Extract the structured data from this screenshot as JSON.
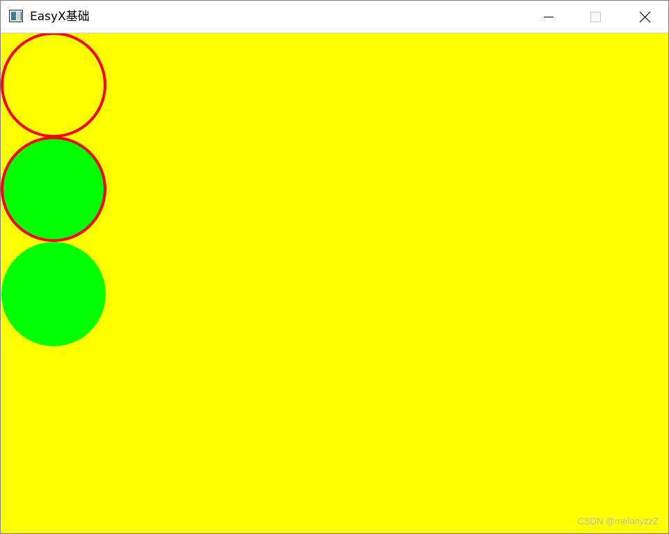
{
  "window": {
    "title": "EasyX基础",
    "buttons": {
      "minimize_icon": "minimize-icon",
      "maximize_icon": "maximize-icon",
      "close_icon": "close-icon"
    }
  },
  "canvas": {
    "background_color": "#ffff00",
    "shapes": [
      {
        "name": "outline-circle",
        "fill": "none",
        "stroke": "#ff0000"
      },
      {
        "name": "filled-outlined-circle",
        "fill": "#00ff00",
        "stroke": "#ff0000"
      },
      {
        "name": "filled-circle",
        "fill": "#00ff00",
        "stroke": "none"
      }
    ]
  },
  "watermark": {
    "text": "CSDN @melonyzzZ"
  }
}
